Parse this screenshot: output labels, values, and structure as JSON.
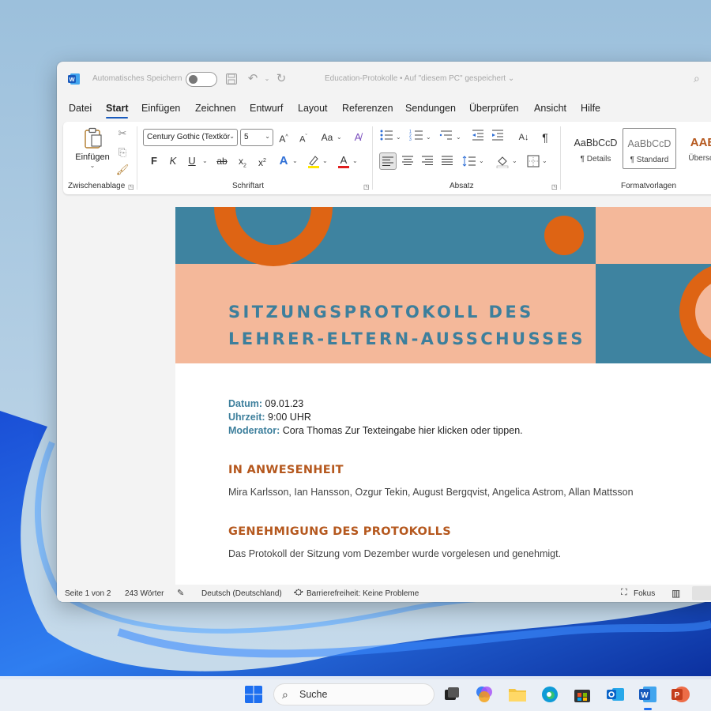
{
  "window": {
    "autosave_label": "Automatisches Speichern",
    "doc_title": "Education-Protokolle • Auf \"diesem PC\" gespeichert"
  },
  "menu": {
    "items": [
      "Datei",
      "Start",
      "Einfügen",
      "Zeichnen",
      "Entwurf",
      "Layout",
      "Referenzen",
      "Sendungen",
      "Überprüfen",
      "Ansicht",
      "Hilfe"
    ],
    "active": "Start"
  },
  "ribbon": {
    "clipboard": {
      "paste_label": "Einfügen",
      "group_label": "Zwischenablage"
    },
    "font": {
      "font_name": "Century Gothic (Textkör",
      "font_size": "5",
      "change_case": "Aa",
      "bold": "F",
      "italic": "K",
      "underline": "U",
      "strike": "ab",
      "group_label": "Schriftart"
    },
    "paragraph": {
      "group_label": "Absatz"
    },
    "styles": {
      "tiles": [
        {
          "sample": "AaBbCcD",
          "name": "¶ Details"
        },
        {
          "sample": "AaBbCcD",
          "name": "¶ Standard"
        },
        {
          "sample": "AAB",
          "name": "Übersch"
        }
      ],
      "group_label": "Formatvorlagen"
    }
  },
  "document": {
    "title_line1": "SITZUNGSPROTOKOLL DES",
    "title_line2": "LEHRER-ELTERN-AUSSCHUSSES",
    "fields": [
      {
        "label": "Datum:",
        "value": " 09.01.23"
      },
      {
        "label": "Uhrzeit:",
        "value": " 9:00 UHR"
      },
      {
        "label": "Moderator:",
        "value": " Cora Thomas Zur Texteingabe hier klicken oder tippen."
      }
    ],
    "sections": [
      {
        "heading": "IN ANWESENHEIT",
        "body": "Mira Karlsson, Ian Hansson, Ozgur Tekin, August Bergqvist, Angelica Astrom, Allan Mattsson"
      },
      {
        "heading": "GENEHMIGUNG DES PROTOKOLLS",
        "body": "Das Protokoll der Sitzung vom Dezember wurde vorgelesen und genehmigt."
      }
    ],
    "colors": {
      "blue": "#3e83a0",
      "peach": "#f4b89a",
      "orange": "#de6414"
    }
  },
  "status": {
    "page": "Seite 1 von 2",
    "words": "243 Wörter",
    "language": "Deutsch (Deutschland)",
    "accessibility": "Barrierefreiheit: Keine Probleme",
    "focus": "Fokus"
  },
  "taskbar": {
    "search_label": "Suche",
    "apps": [
      "start-icon",
      "search-icon",
      "task-view-icon",
      "copilot-icon",
      "file-explorer-icon",
      "edge-icon",
      "store-icon",
      "outlook-icon",
      "word-icon",
      "powerpoint-icon"
    ]
  }
}
